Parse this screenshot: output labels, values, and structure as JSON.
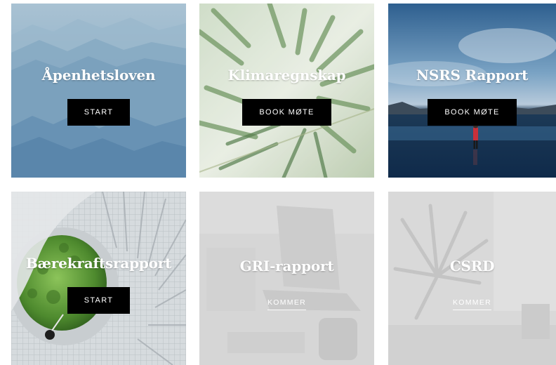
{
  "cards": [
    {
      "title": "Åpenhetsloven",
      "action": "START",
      "state": "active",
      "image": "misty-blue-mountains"
    },
    {
      "title": "Klimaregnskap",
      "action": "BOOK MØTE",
      "state": "active",
      "image": "palm-leaves"
    },
    {
      "title": "NSRS Rapport",
      "action": "BOOK MØTE",
      "state": "active",
      "image": "person-on-reflective-beach"
    },
    {
      "title": "Bærekraftsrapport",
      "action": "START",
      "state": "active",
      "image": "spiral-staircase-with-garden"
    },
    {
      "title": "GRI-rapport",
      "action": "KOMMER",
      "state": "coming-soon",
      "image": "faded-laptop-desk"
    },
    {
      "title": "CSRD",
      "action": "KOMMER",
      "state": "coming-soon",
      "image": "faded-palm-office"
    }
  ]
}
